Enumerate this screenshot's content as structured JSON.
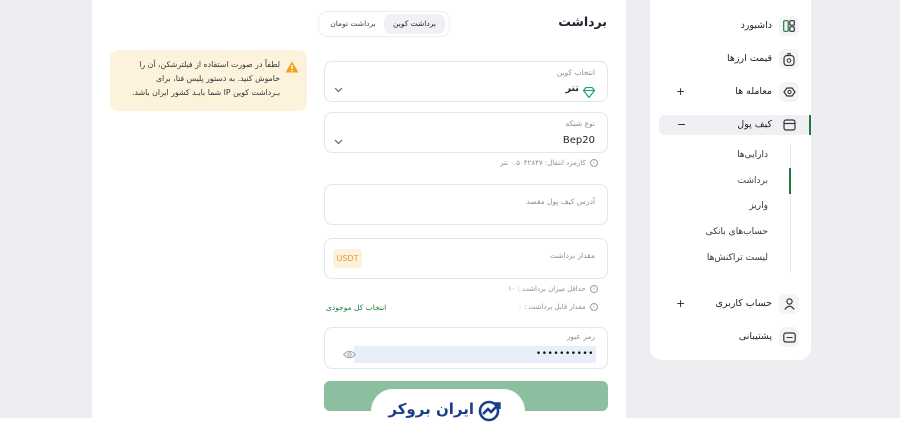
{
  "page": {
    "title": "برداشت"
  },
  "tabs": {
    "coin": "برداشت کوین",
    "toman": "برداشت تومان"
  },
  "warning": {
    "line1": "لطفاً در صورت استفاده از فیلترشکن، آن را",
    "line2": "خاموش کنید. به دستور پلیس فتا، برای",
    "line3": "بـرداشت کوین IP شما بایـد کشور ایران باشد."
  },
  "form": {
    "coin_label": "انتخاب کوین",
    "coin_value": "تتر",
    "network_label": "نوع شبکه",
    "network_value": "Bep20",
    "fee_text": "کارمزد انتقال: ۰.۵۰۴۲۸۴۷ تتر",
    "address_placeholder": "آدرس کیف پول مقصد",
    "amount_placeholder": "مقدار برداشت",
    "amount_unit": "USDT",
    "min_text": "حداقل میزان برداشت : ۱۰",
    "max_text": "مقدار قابل برداشت : ۰",
    "select_all": "انتخاب کل موجودی",
    "password_label": "رمز عبور",
    "password_value": "••••••••••"
  },
  "logo": {
    "text": "ایران بروکر"
  },
  "sidebar": {
    "items": [
      {
        "label": "داشبورد",
        "icon": "dashboard-icon"
      },
      {
        "label": "قیمت ارزها",
        "icon": "coin-price-icon"
      },
      {
        "label": "معامله ها",
        "icon": "trade-icon",
        "toggle": "+"
      },
      {
        "label": "کیف پول",
        "icon": "wallet-icon",
        "toggle": "−"
      },
      {
        "label": "حساب کاربری",
        "icon": "user-icon",
        "toggle": "+"
      },
      {
        "label": "پشتیبانی",
        "icon": "support-icon"
      }
    ],
    "wallet_sub": [
      "دارایی‌ها",
      "برداشت",
      "واریز",
      "حساب‌های بانکی",
      "لیست تراکنش‌ها"
    ]
  },
  "colors": {
    "accent": "#1f7a3a",
    "warn_bg": "#fdf3dd",
    "warn_icon": "#f0a21a",
    "button_bg": "#8bbf9f",
    "gem": "#1aa36f",
    "unit_bg": "#fdf1dc",
    "unit_text": "#e0a030"
  }
}
